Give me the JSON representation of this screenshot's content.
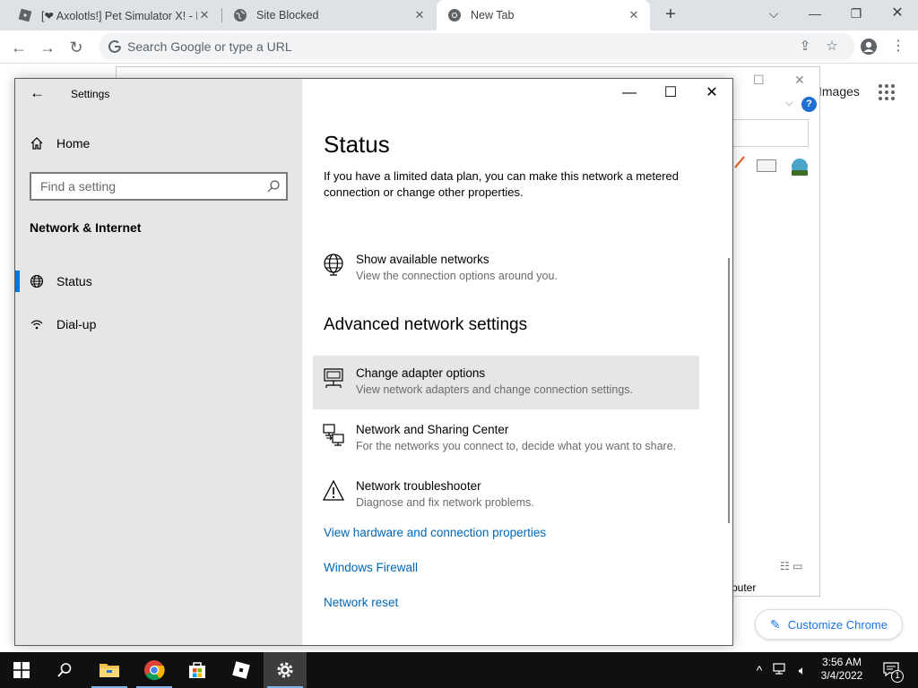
{
  "chrome": {
    "tabs": [
      {
        "title": "[❤ Axolotls!] Pet Simulator X! - Ro",
        "icon": "roblox-icon"
      },
      {
        "title": "Site Blocked",
        "icon": "globe-icon"
      },
      {
        "title": "New Tab",
        "icon": "chrome-icon",
        "active": true
      }
    ],
    "omnibox_placeholder": "Search Google or type a URL",
    "images_link": "Images",
    "customize_label": "Customize Chrome",
    "bg_partial_text": "puter"
  },
  "settings": {
    "window_title": "Settings",
    "home_label": "Home",
    "search_placeholder": "Find a setting",
    "section_title": "Network & Internet",
    "nav": [
      {
        "label": "Status",
        "icon": "globe-icon",
        "active": true
      },
      {
        "label": "Dial-up",
        "icon": "dialup-icon",
        "active": false
      }
    ],
    "page_title": "Status",
    "page_description": "If you have a limited data plan, you can make this network a metered connection or change other properties.",
    "show_networks": {
      "title": "Show available networks",
      "subtitle": "View the connection options around you."
    },
    "advanced_heading": "Advanced network settings",
    "advanced_items": [
      {
        "title": "Change adapter options",
        "subtitle": "View network adapters and change connection settings.",
        "icon": "adapter-icon"
      },
      {
        "title": "Network and Sharing Center",
        "subtitle": "For the networks you connect to, decide what you want to share.",
        "icon": "sharing-center-icon"
      },
      {
        "title": "Network troubleshooter",
        "subtitle": "Diagnose and fix network problems.",
        "icon": "warning-icon"
      }
    ],
    "links": [
      "View hardware and connection properties",
      "Windows Firewall",
      "Network reset"
    ]
  },
  "taskbar": {
    "time": "3:56 AM",
    "date": "3/4/2022",
    "notification_count": "1",
    "apps": [
      "start-icon",
      "search-icon",
      "file-explorer-icon",
      "chrome-icon",
      "store-icon",
      "roblox-icon",
      "settings-icon"
    ]
  }
}
